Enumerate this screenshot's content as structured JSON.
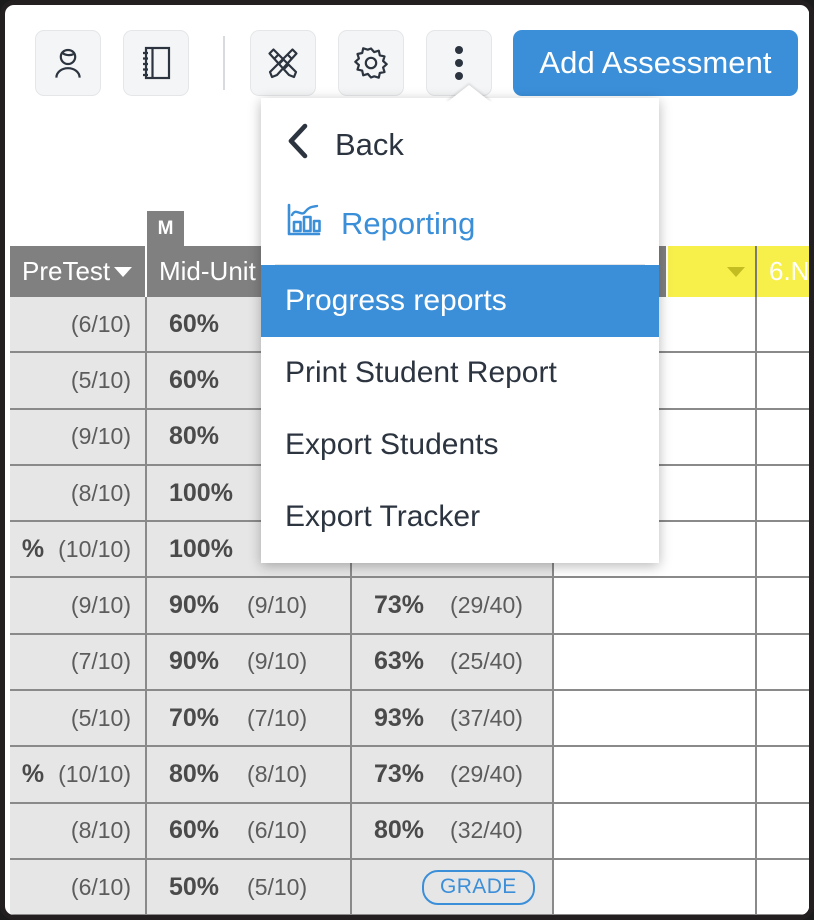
{
  "toolbar": {
    "buttons": [
      {
        "name": "student-icon",
        "label": "Students"
      },
      {
        "name": "book-icon",
        "label": "Notebook"
      },
      {
        "name": "design-icon",
        "label": "Design"
      },
      {
        "name": "gear-icon",
        "label": "Settings"
      },
      {
        "name": "kebab-icon",
        "label": "More"
      }
    ],
    "add_assessment_label": "Add Assessment",
    "accent_color": "#3b8fd9"
  },
  "menu": {
    "back_label": "Back",
    "reporting_label": "Reporting",
    "reporting_icon": "bar-chart-icon",
    "items": [
      {
        "label": "Progress reports",
        "selected": true
      },
      {
        "label": "Print Student Report",
        "selected": false
      },
      {
        "label": "Export Students",
        "selected": false
      },
      {
        "label": "Export Tracker",
        "selected": false
      }
    ],
    "highlight_color": "#3b8fd9"
  },
  "grid": {
    "unit_tab_label": "M",
    "header_bg": "#808080",
    "highlight_header_bg": "#f7ef4a",
    "columns": [
      {
        "label": "PreTest",
        "has_caret": true,
        "style": "grey"
      },
      {
        "label": "Mid-Unit",
        "has_caret": false,
        "style": "grey"
      },
      {
        "label": "",
        "has_caret": false,
        "style": "grey"
      },
      {
        "label": "",
        "has_caret": true,
        "style": "yellow"
      },
      {
        "label": "6.N",
        "has_caret": false,
        "style": "yellow"
      }
    ],
    "rows": [
      {
        "pre_pct": "",
        "pre_frac": "(6/10)",
        "mid_pct": "60%",
        "mid_frac": "",
        "tot_pct": "",
        "tot_frac": ""
      },
      {
        "pre_pct": "",
        "pre_frac": "(5/10)",
        "mid_pct": "60%",
        "mid_frac": "",
        "tot_pct": "",
        "tot_frac": ""
      },
      {
        "pre_pct": "",
        "pre_frac": "(9/10)",
        "mid_pct": "80%",
        "mid_frac": "",
        "tot_pct": "",
        "tot_frac": ""
      },
      {
        "pre_pct": "",
        "pre_frac": "(8/10)",
        "mid_pct": "100%",
        "mid_frac": "(",
        "tot_pct": "",
        "tot_frac": ""
      },
      {
        "pre_pct": "%",
        "pre_frac": "(10/10)",
        "mid_pct": "100%",
        "mid_frac": "(",
        "tot_pct": "",
        "tot_frac": ""
      },
      {
        "pre_pct": "",
        "pre_frac": "(9/10)",
        "mid_pct": "90%",
        "mid_frac": "(9/10)",
        "tot_pct": "73%",
        "tot_frac": "(29/40)"
      },
      {
        "pre_pct": "",
        "pre_frac": "(7/10)",
        "mid_pct": "90%",
        "mid_frac": "(9/10)",
        "tot_pct": "63%",
        "tot_frac": "(25/40)"
      },
      {
        "pre_pct": "",
        "pre_frac": "(5/10)",
        "mid_pct": "70%",
        "mid_frac": "(7/10)",
        "tot_pct": "93%",
        "tot_frac": "(37/40)"
      },
      {
        "pre_pct": "%",
        "pre_frac": "(10/10)",
        "mid_pct": "80%",
        "mid_frac": "(8/10)",
        "tot_pct": "73%",
        "tot_frac": "(29/40)"
      },
      {
        "pre_pct": "",
        "pre_frac": "(8/10)",
        "mid_pct": "60%",
        "mid_frac": "(6/10)",
        "tot_pct": "80%",
        "tot_frac": "(32/40)"
      },
      {
        "pre_pct": "",
        "pre_frac": "(6/10)",
        "mid_pct": "50%",
        "mid_frac": "(5/10)",
        "tot_pct": "",
        "tot_frac": "",
        "grade_badge": "GRADE"
      }
    ]
  }
}
